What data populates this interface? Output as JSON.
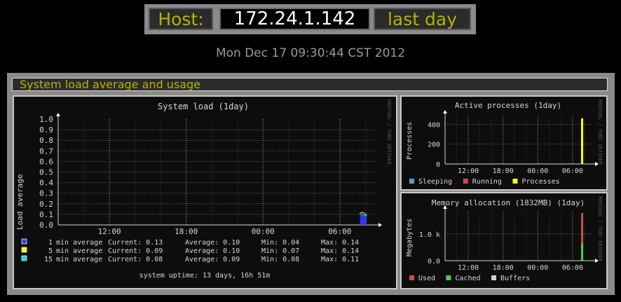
{
  "header": {
    "host_label": "Host:",
    "host_value": "172.24.1.142",
    "period_label": "last day",
    "accent_color": "#b3b300"
  },
  "date": "Mon Dec 17 09:30:44 CST 2012",
  "section": {
    "title": "System load average and usage"
  },
  "watermark": "RRDTOOL / TOBI OETIKER",
  "charts": {
    "load": {
      "title": "System load   (1day)",
      "uptime": "system uptime: 13 days, 16h 51m"
    },
    "processes": {
      "title": "Active processes  (1day)"
    },
    "memory": {
      "title": "Memory allocation (1832MB)  (1day)"
    }
  },
  "chart_data": [
    {
      "type": "area",
      "title": "System load   (1day)",
      "ylabel": "Load average",
      "xlabel": "",
      "ylim": [
        0,
        1.0
      ],
      "yticks": [
        "0.0",
        "0.1",
        "0.2",
        "0.3",
        "0.4",
        "0.5",
        "0.6",
        "0.7",
        "0.8",
        "0.9",
        "1.0"
      ],
      "xticks": [
        "12:00",
        "18:00",
        "00:00",
        "06:00"
      ],
      "xlim_hours": [
        8.0,
        32.8
      ],
      "grid": true,
      "series": [
        {
          "name": "1 min average",
          "color": "#3a3aff",
          "current": "0.13",
          "average": "0.10",
          "min": "0.04",
          "max": "0.14",
          "points": [
            [
              31.55,
              0.0
            ],
            [
              31.6,
              0.1
            ],
            [
              32.0,
              0.09
            ],
            [
              32.1,
              0.13
            ]
          ]
        },
        {
          "name": "5 min average",
          "color": "#ffff00",
          "current": "0.09",
          "average": "0.10",
          "min": "0.07",
          "max": "0.14",
          "points": [
            [
              31.55,
              0.11
            ],
            [
              31.8,
              0.12
            ],
            [
              32.1,
              0.09
            ]
          ]
        },
        {
          "name": "15 min average",
          "color": "#00e0e0",
          "current": "0.08",
          "average": "0.09",
          "min": "0.08",
          "max": "0.11",
          "points": [
            [
              31.55,
              0.1
            ],
            [
              31.8,
              0.1
            ],
            [
              32.1,
              0.08
            ]
          ]
        }
      ],
      "legend_stats_labels": {
        "current": "Current:",
        "average": "Average:",
        "min": "Min:",
        "max": "Max:"
      }
    },
    {
      "type": "area",
      "title": "Active processes  (1day)",
      "ylabel": "Processes",
      "ylim": [
        0,
        480
      ],
      "yticks": [
        "0",
        "200",
        "400"
      ],
      "ytick_values": [
        0,
        200,
        400
      ],
      "xticks": [
        "12:00",
        "18:00",
        "00:00",
        "06:00"
      ],
      "xlim_hours": [
        8.0,
        33.4
      ],
      "grid": true,
      "series": [
        {
          "name": "Sleeping",
          "color": "#5a9fd0",
          "points": [
            [
              31.65,
              455
            ]
          ]
        },
        {
          "name": "Running",
          "color": "#d04a4a",
          "points": [
            [
              31.65,
              2
            ]
          ]
        },
        {
          "name": "Processes",
          "color": "#ffff00",
          "points": [
            [
              31.65,
              460
            ]
          ]
        }
      ]
    },
    {
      "type": "area",
      "title": "Memory allocation (1832MB)  (1day)",
      "ylabel": "Megabytes",
      "ylim": [
        0,
        1832
      ],
      "yticks": [
        "0.0",
        "1.0 k"
      ],
      "ytick_values": [
        0,
        1000
      ],
      "xticks": [
        "12:00",
        "18:00",
        "00:00",
        "06:00"
      ],
      "xlim_hours": [
        8.0,
        33.4
      ],
      "grid": true,
      "series": [
        {
          "name": "Used",
          "color": "#d04a4a",
          "points": [
            [
              31.65,
              1780
            ]
          ]
        },
        {
          "name": "Cached",
          "color": "#4ad04a",
          "points": [
            [
              31.65,
              650
            ]
          ]
        },
        {
          "name": "Buffers",
          "color": "#d0d0d0",
          "points": [
            [
              31.65,
              20
            ]
          ]
        }
      ]
    }
  ]
}
